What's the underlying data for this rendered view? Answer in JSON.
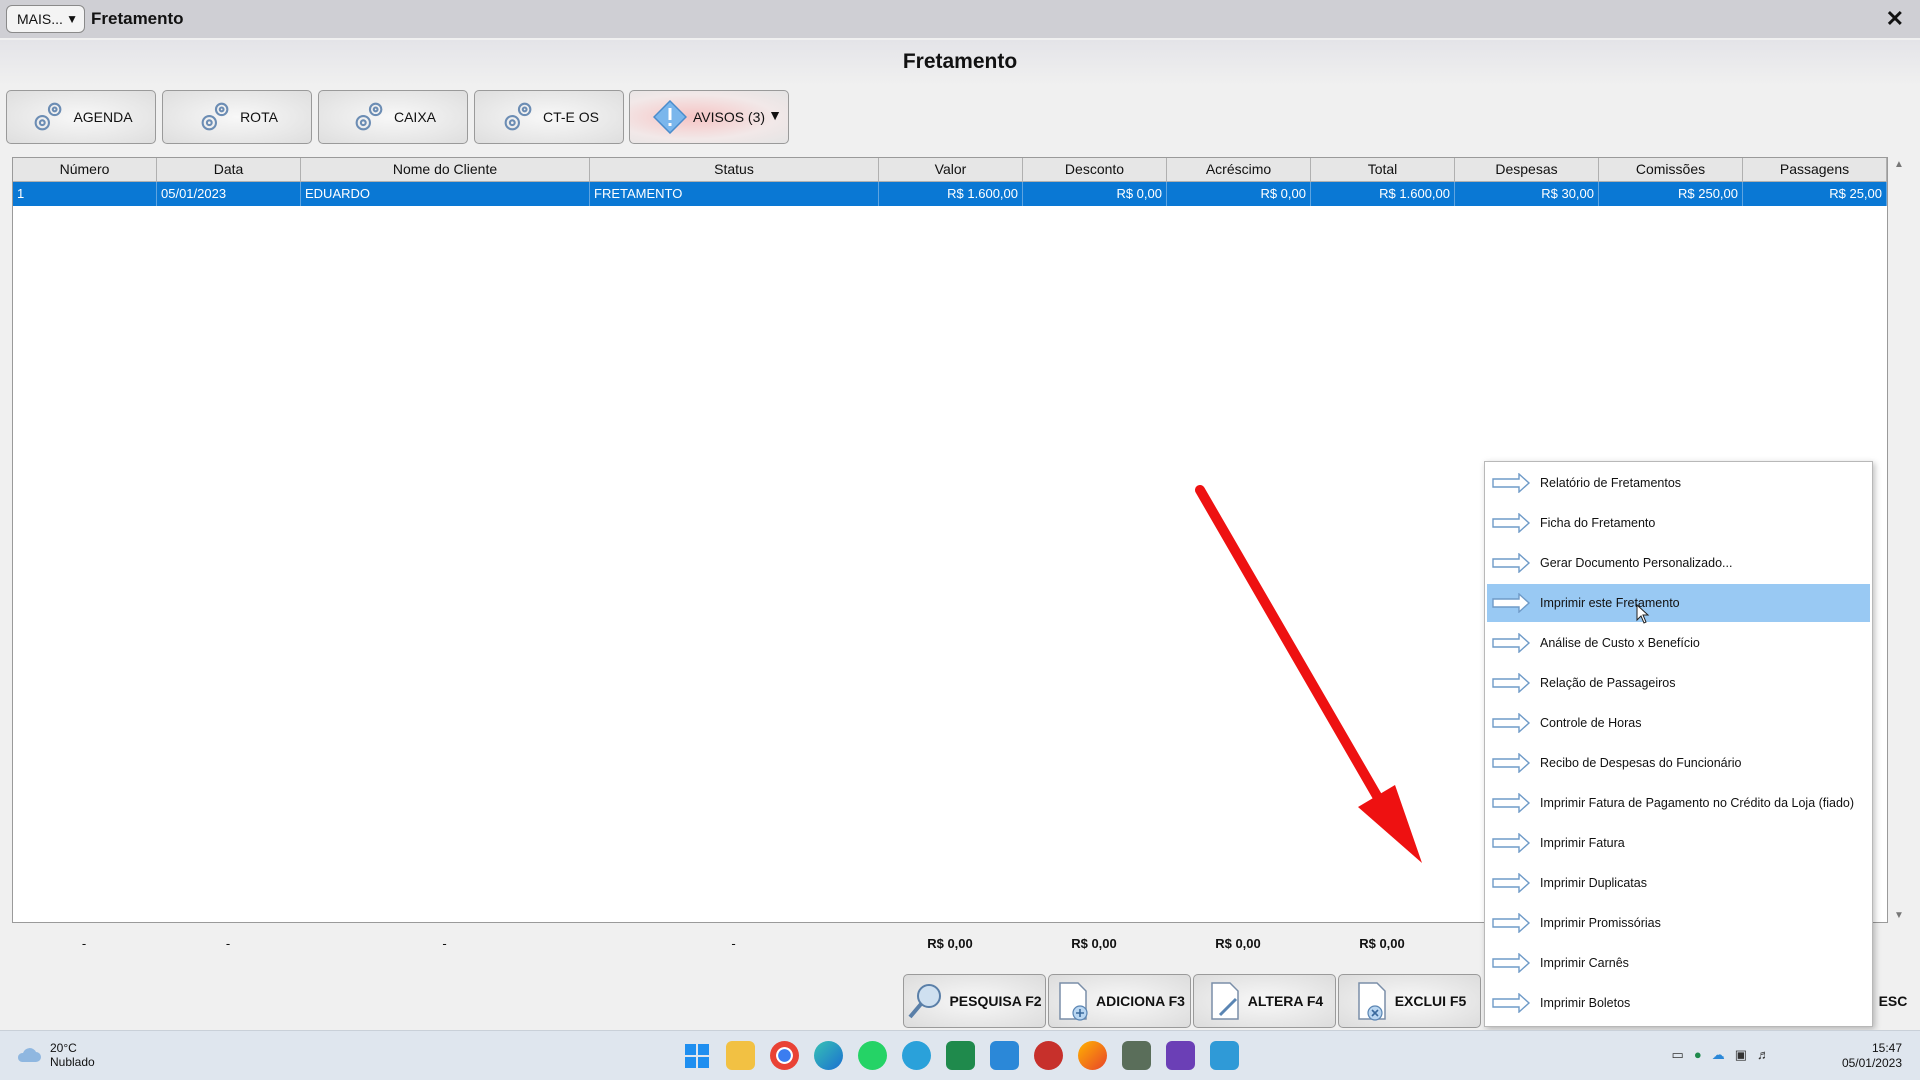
{
  "window": {
    "title": "Fretamento",
    "more_label": "MAIS...",
    "close_glyph": "✕"
  },
  "page_title": "Fretamento",
  "top_buttons": [
    {
      "label": "AGENDA",
      "icon": "gear-icon"
    },
    {
      "label": "ROTA",
      "icon": "gear-icon"
    },
    {
      "label": "CAIXA",
      "icon": "gear-icon"
    },
    {
      "label": "CT-E OS",
      "icon": "gear-icon"
    },
    {
      "label": "AVISOS (3)",
      "icon": "warning-diamond-icon"
    }
  ],
  "grid": {
    "columns": [
      "Número",
      "Data",
      "Nome do Cliente",
      "Status",
      "Valor",
      "Desconto",
      "Acréscimo",
      "Total",
      "Despesas",
      "Comissões",
      "Passagens"
    ],
    "rows": [
      [
        "1",
        "05/01/2023",
        "EDUARDO",
        "FRETAMENTO",
        "R$ 1.600,00",
        "R$ 0,00",
        "R$ 0,00",
        "R$ 1.600,00",
        "R$ 30,00",
        "R$ 250,00",
        "R$ 25,00"
      ]
    ],
    "selected_color": "#0a78d4"
  },
  "totals": [
    "-",
    "-",
    "-",
    "-",
    "R$ 0,00",
    "R$ 0,00",
    "R$ 0,00",
    "R$ 0,00"
  ],
  "bottom_buttons": [
    {
      "label": "PESQUISA F2",
      "icon": "magnifier-icon"
    },
    {
      "label": "ADICIONA F3",
      "icon": "add-document-icon"
    },
    {
      "label": "ALTERA F4",
      "icon": "edit-document-icon"
    },
    {
      "label": "EXCLUI F5",
      "icon": "delete-document-icon"
    }
  ],
  "esc_label": "ESC",
  "context_menu": {
    "highlighted_index": 3,
    "items": [
      "Relatório de Fretamentos",
      "Ficha do Fretamento",
      "Gerar Documento Personalizado...",
      "Imprimir este Fretamento",
      "Análise de Custo x Benefício",
      "Relação de Passageiros",
      "Controle de Horas",
      "Recibo de Despesas do Funcionário",
      "Imprimir Fatura de Pagamento no Crédito da Loja (fiado)",
      "Imprimir Fatura",
      "Imprimir Duplicatas",
      "Imprimir Promissórias",
      "Imprimir Carnês",
      "Imprimir Boletos"
    ]
  },
  "taskbar": {
    "temperature": "20°C",
    "weather": "Nublado",
    "time": "15:47",
    "date": "05/01/2023",
    "apps": [
      "windows-start-icon",
      "file-explorer-icon",
      "chrome-icon",
      "edge-icon",
      "whatsapp-icon",
      "telegram-icon",
      "spreadsheet-icon",
      "mail-icon",
      "app-icon",
      "firefox-icon",
      "system-app-icon",
      "video-editor-icon",
      "folder-app-icon"
    ]
  },
  "colors": {
    "highlight_menu": "#99c9f3",
    "arrow": "#ee1111",
    "avisos_tint": "#f6c4c4"
  }
}
